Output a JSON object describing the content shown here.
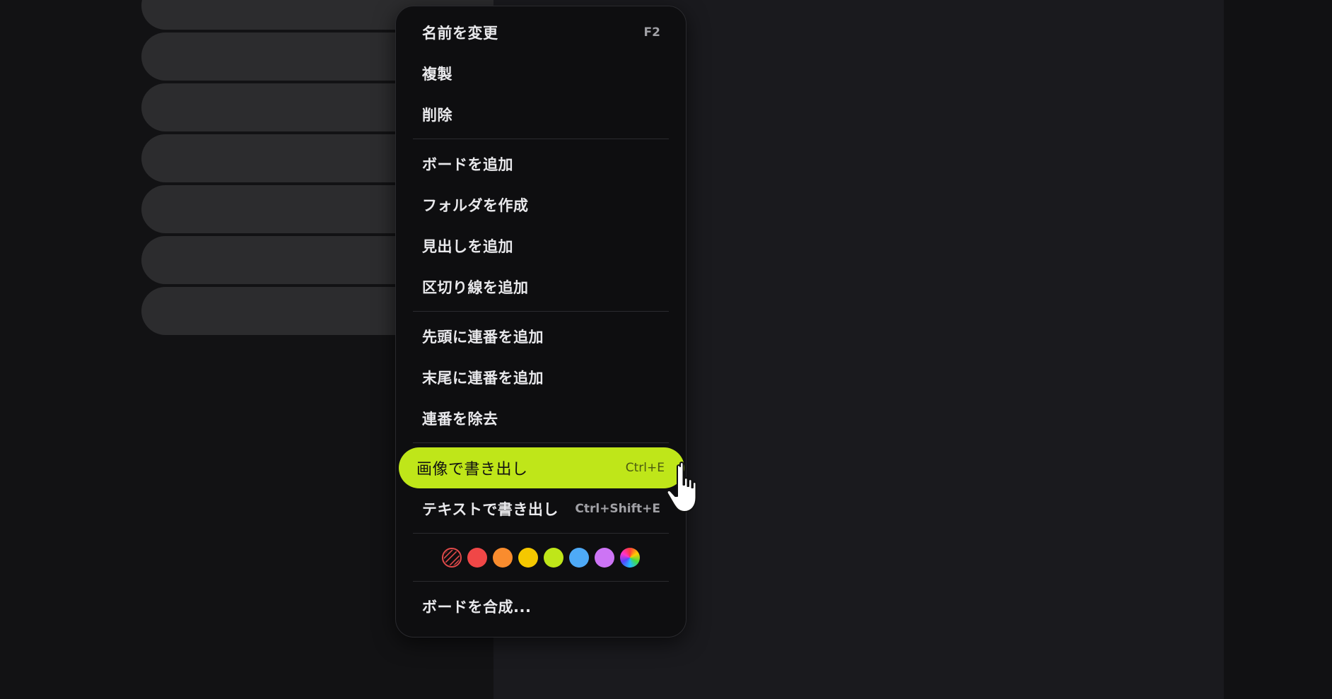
{
  "board_list": {
    "count": 7
  },
  "context_menu": {
    "group1": [
      {
        "label": "名前を変更",
        "shortcut": "F2"
      },
      {
        "label": "複製",
        "shortcut": ""
      },
      {
        "label": "削除",
        "shortcut": ""
      }
    ],
    "group2": [
      {
        "label": "ボードを追加"
      },
      {
        "label": "フォルダを作成"
      },
      {
        "label": "見出しを追加"
      },
      {
        "label": "区切り線を追加"
      }
    ],
    "group3": [
      {
        "label": "先頭に連番を追加"
      },
      {
        "label": "末尾に連番を追加"
      },
      {
        "label": "連番を除去"
      }
    ],
    "group4": [
      {
        "label": "画像で書き出し",
        "shortcut": "Ctrl+E",
        "highlighted": true
      },
      {
        "label": "テキストで書き出し",
        "shortcut": "Ctrl+Shift+E"
      }
    ],
    "colors": [
      {
        "name": "none",
        "hex": "transparent"
      },
      {
        "name": "red",
        "hex": "#f04747"
      },
      {
        "name": "orange",
        "hex": "#f98c2e"
      },
      {
        "name": "yellow",
        "hex": "#f5c800"
      },
      {
        "name": "lime",
        "hex": "#bfe619"
      },
      {
        "name": "blue",
        "hex": "#4eaaf7"
      },
      {
        "name": "purple",
        "hex": "#cd74f5"
      },
      {
        "name": "rainbow",
        "hex": "conic"
      }
    ],
    "group5": [
      {
        "label": "ボードを合成..."
      }
    ]
  },
  "colors": {
    "accent": "#bfe619",
    "menu_bg": "#0e0e10",
    "pill_bg": "#2c2c2e"
  },
  "icons": {
    "cursor": "hand-pointer-icon",
    "no_color": "no-color-icon"
  }
}
